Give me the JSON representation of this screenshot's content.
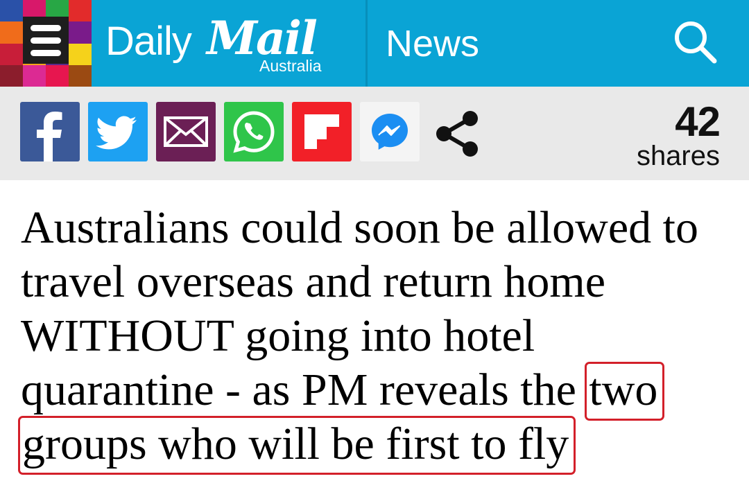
{
  "header": {
    "mosaic_colors": [
      "#2a51a8",
      "#d8186a",
      "#28a745",
      "#e22b2b",
      "#f06c1b",
      "#e2137d",
      "#1aa0d9",
      "#7a1b8a",
      "#c81e39",
      "#f3a41b",
      "#5a2a8a",
      "#f5d21b",
      "#8b1d2c",
      "#dc2a93",
      "#e7164f",
      "#9b4a12"
    ],
    "menu_icon": "hamburger-menu-icon",
    "logo_daily": "Daily",
    "logo_mail": "Mail",
    "logo_region": "Australia",
    "section_label": "News",
    "search_icon": "search-icon",
    "background_color": "#0aa4d5"
  },
  "share_bar": {
    "buttons": [
      {
        "network": "facebook",
        "icon": "facebook-icon",
        "color": "#3b5998"
      },
      {
        "network": "twitter",
        "icon": "twitter-icon",
        "color": "#1da1f2"
      },
      {
        "network": "email",
        "icon": "email-icon",
        "color": "#6b1f55"
      },
      {
        "network": "whatsapp",
        "icon": "whatsapp-icon",
        "color": "#2fc54a"
      },
      {
        "network": "flipboard",
        "icon": "flipboard-icon",
        "color": "#f22028"
      },
      {
        "network": "messenger",
        "icon": "messenger-icon",
        "color": "#f4f4f4"
      }
    ],
    "generic_share_icon": "share-icon",
    "count": "42",
    "count_label": "shares",
    "background_color": "#e9e9e9"
  },
  "article": {
    "headline_before": "Australians could soon be allowed to travel overseas and return home WITHOUT going into hotel quarantine - as PM reveals the ",
    "headline_highlight_1": "two",
    "headline_highlight_2": "groups who will be first to fly",
    "highlight_color": "#d3202a"
  }
}
